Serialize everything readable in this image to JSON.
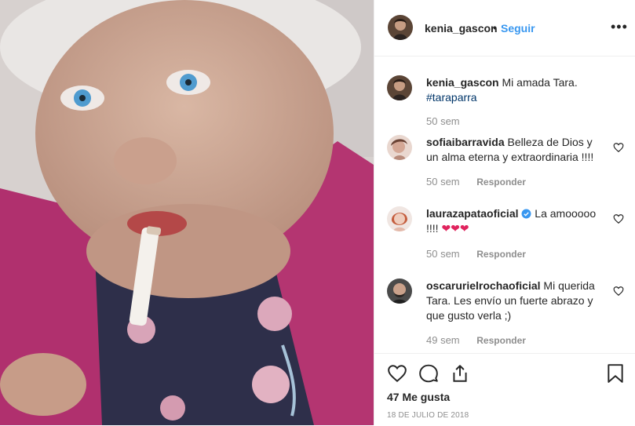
{
  "post": {
    "author": "kenia_gascon",
    "separator": "•",
    "follow_label": "Seguir",
    "more_label": "•••",
    "caption": {
      "author": "kenia_gascon",
      "text": "Mi amada Tara.",
      "hashtag": "#taraparra",
      "time": "50 sem"
    }
  },
  "comments": [
    {
      "user": "sofiaibarravida",
      "text": "Belleza de Dios y un alma eterna y extraordinaria !!!!",
      "time": "50 sem",
      "reply": "Responder"
    },
    {
      "user": "laurazapataoficial",
      "text": "La amooooo !!!!",
      "hearts": "❤❤❤",
      "time": "50 sem",
      "reply": "Responder",
      "verified": true
    },
    {
      "user": "oscaruriel rochaoficial",
      "text": "Mi querida Tara. Les envío un fuerte abrazo y que gusto verla ;)",
      "time": "49 sem",
      "reply": "Responder"
    }
  ],
  "footer": {
    "likes": "47 Me gusta",
    "date": "18 DE JULIO DE 2018"
  },
  "colors": {
    "link": "#3897f0",
    "hashtag": "#003569",
    "muted": "#8e8e8e",
    "text": "#262626",
    "cardigan": "#b0306e"
  },
  "icons": [
    "like-icon",
    "comment-icon",
    "share-icon",
    "save-icon",
    "verified-icon",
    "more-icon"
  ]
}
